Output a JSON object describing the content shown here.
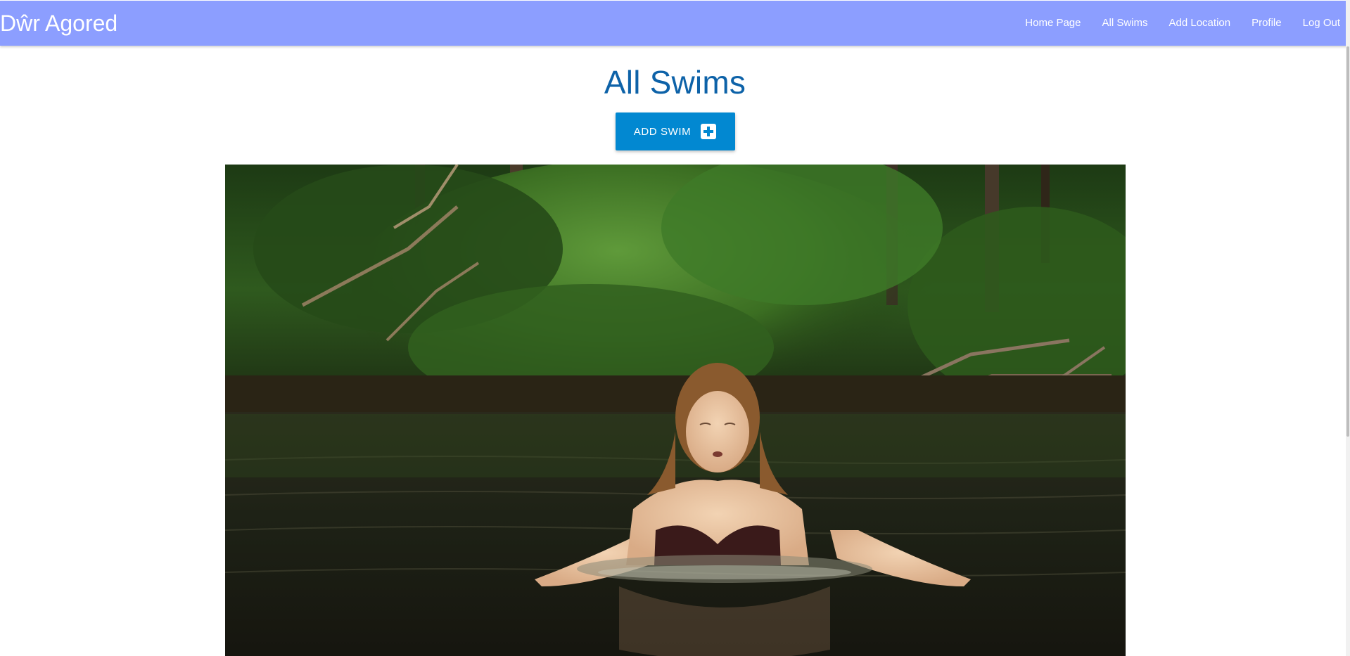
{
  "app": {
    "brand": "Dŵr Agored"
  },
  "nav": {
    "items": [
      {
        "label": "Home Page"
      },
      {
        "label": "All Swims"
      },
      {
        "label": "Add Location"
      },
      {
        "label": "Profile"
      },
      {
        "label": "Log Out"
      }
    ]
  },
  "main": {
    "title": "All Swims",
    "add_button_label": "ADD SWIM",
    "add_button_icon": "plus-square-icon"
  },
  "colors": {
    "navbar": "#8c9eff",
    "title": "#0d62a8",
    "button": "#0288d1"
  }
}
